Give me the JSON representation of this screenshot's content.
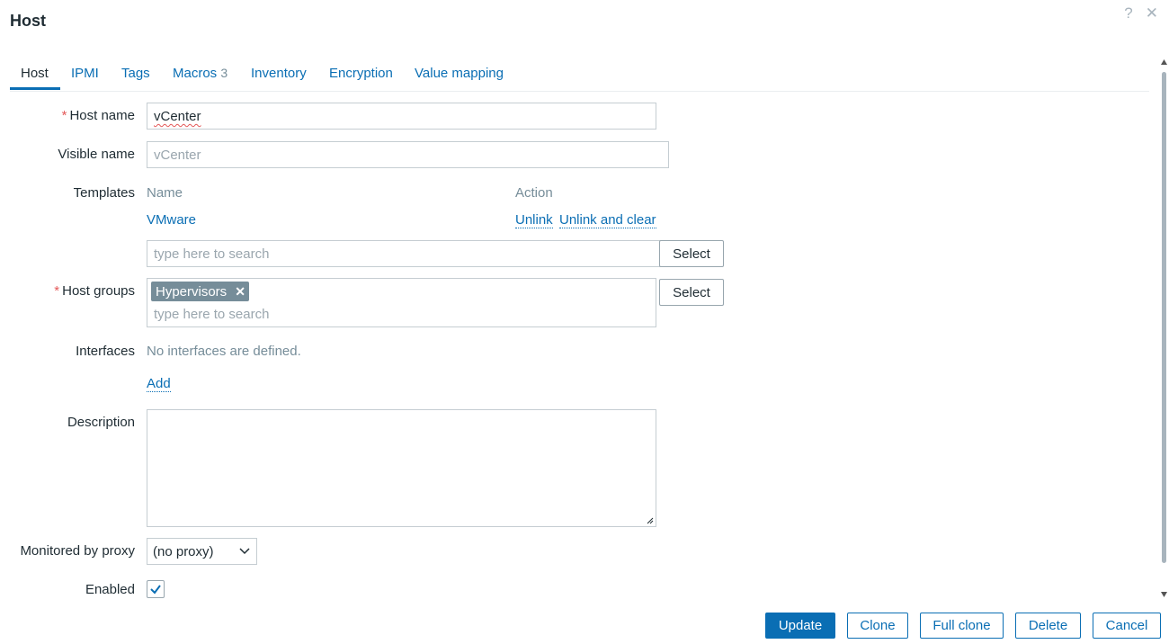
{
  "dialog": {
    "title": "Host",
    "help_icon": "?",
    "close_icon": "✕"
  },
  "tabs": [
    {
      "label": "Host"
    },
    {
      "label": "IPMI"
    },
    {
      "label": "Tags"
    },
    {
      "label": "Macros",
      "count": "3"
    },
    {
      "label": "Inventory"
    },
    {
      "label": "Encryption"
    },
    {
      "label": "Value mapping"
    }
  ],
  "form": {
    "host_name": {
      "label": "Host name",
      "value": "vCenter"
    },
    "visible_name": {
      "label": "Visible name",
      "placeholder": "vCenter"
    },
    "templates": {
      "label": "Templates",
      "col_name": "Name",
      "col_action": "Action",
      "items": [
        {
          "name": "VMware",
          "unlink": "Unlink",
          "unlink_clear": "Unlink and clear"
        }
      ],
      "search_placeholder": "type here to search",
      "select_label": "Select"
    },
    "host_groups": {
      "label": "Host groups",
      "chips": [
        "Hypervisors"
      ],
      "search_placeholder": "type here to search",
      "select_label": "Select"
    },
    "interfaces": {
      "label": "Interfaces",
      "empty_text": "No interfaces are defined.",
      "add_label": "Add"
    },
    "description": {
      "label": "Description",
      "value": ""
    },
    "proxy": {
      "label": "Monitored by proxy",
      "value": "(no proxy)"
    },
    "enabled": {
      "label": "Enabled",
      "checked": true
    }
  },
  "footer": {
    "update": "Update",
    "clone": "Clone",
    "full_clone": "Full clone",
    "delete": "Delete",
    "cancel": "Cancel"
  },
  "colors": {
    "accent": "#0a6eb4",
    "required": "#e45959",
    "chip": "#768d99"
  }
}
